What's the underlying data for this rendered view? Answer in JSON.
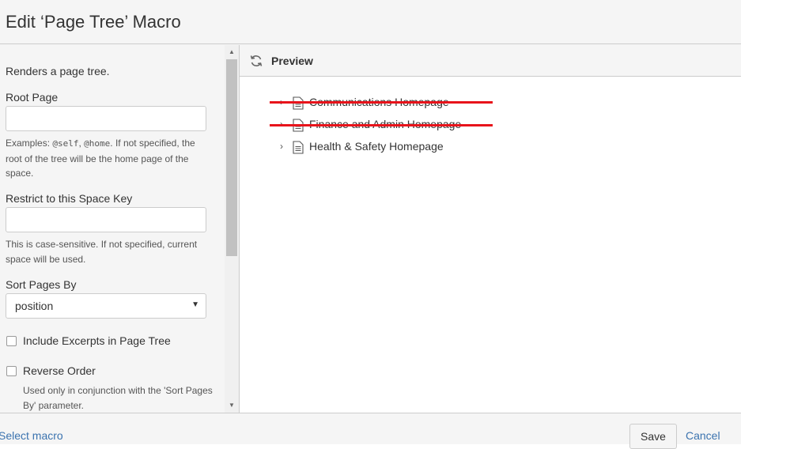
{
  "header": {
    "title": "Edit ‘Page Tree’ Macro"
  },
  "form": {
    "description": "Renders a page tree.",
    "root_page": {
      "label": "Root Page",
      "value": "",
      "help_prefix": "Examples: ",
      "help_code_1": "@self",
      "help_sep": ", ",
      "help_code_2": "@home",
      "help_suffix": ". If not specified, the root of the tree will be the home page of the space."
    },
    "space_key": {
      "label": "Restrict to this Space Key",
      "value": "",
      "help": "This is case-sensitive. If not specified, current space will be used."
    },
    "sort": {
      "label": "Sort Pages By",
      "selected": "position"
    },
    "excerpts": {
      "label": "Include Excerpts in Page Tree",
      "checked": false
    },
    "reverse": {
      "label": "Reverse Order",
      "checked": false,
      "help": "Used only in conjunction with the 'Sort Pages By' parameter."
    }
  },
  "preview": {
    "title": "Preview",
    "items": [
      {
        "label": "Communications Homepage",
        "struck": true
      },
      {
        "label": "Finance and Admin Homepage",
        "struck": true
      },
      {
        "label": "Health & Safety Homepage",
        "struck": false
      }
    ]
  },
  "footer": {
    "select_macro": "Select macro",
    "save": "Save",
    "cancel": "Cancel"
  },
  "colors": {
    "link": "#3b73af",
    "strike": "#e8131b",
    "panel_bg": "#f5f5f5"
  }
}
